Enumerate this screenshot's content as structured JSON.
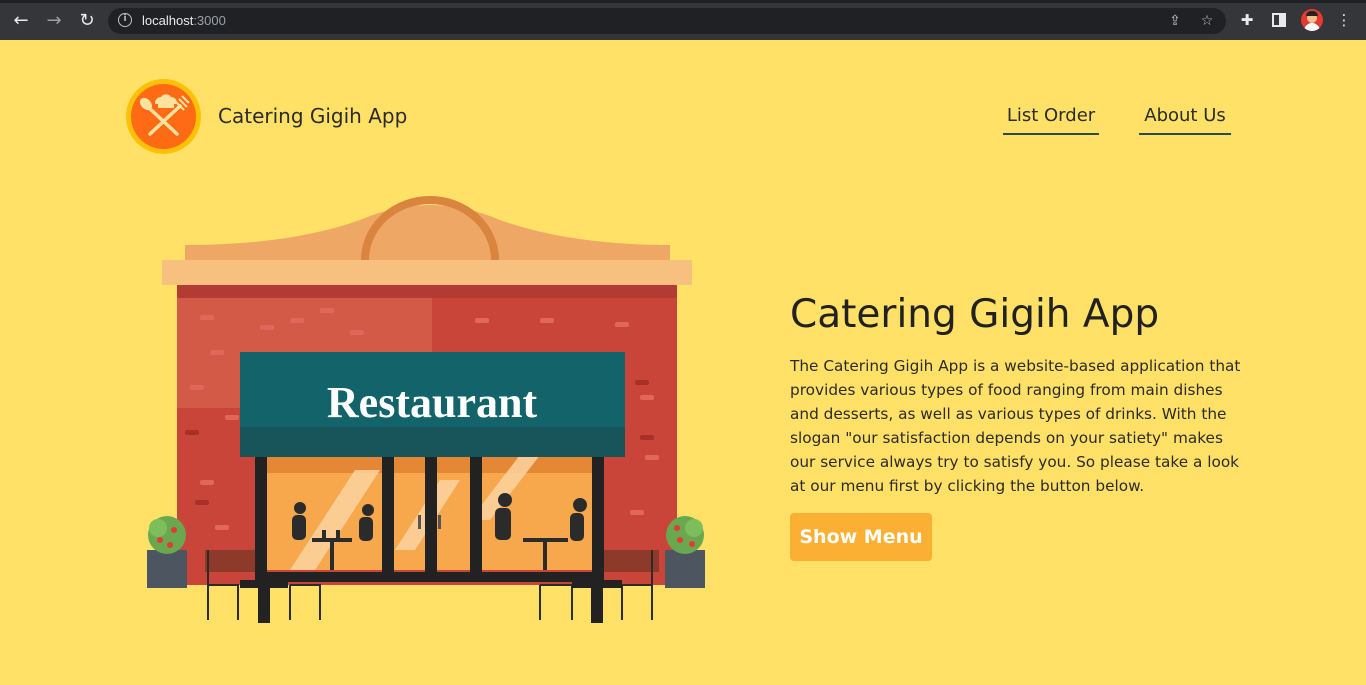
{
  "browser": {
    "url_host": "localhost",
    "url_port": ":3000"
  },
  "navbar": {
    "brand": "Catering Gigih App",
    "links": [
      "List Order",
      "About Us"
    ]
  },
  "hero": {
    "title": "Catering Gigih App",
    "description": "The Catering Gigih App is a website-based application that provides various types of food ranging from main dishes and desserts, as well as various types of drinks. With the slogan \"our satisfaction depends on your satiety\" makes our service always try to satisfy you. So please take a look at our menu first by clicking the button below.",
    "button": "Show Menu",
    "image_sign": "Restaurant"
  },
  "colors": {
    "background": "#ffe168",
    "button": "#fbb034",
    "logo_ring": "#ffc107",
    "logo_fill": "#ff6a14",
    "awning": "#13636a",
    "wall": "#c9453a"
  }
}
